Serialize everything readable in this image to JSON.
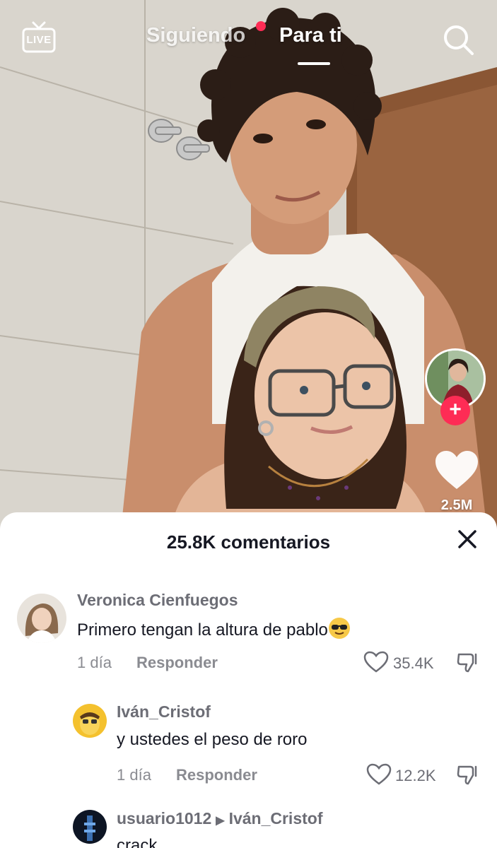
{
  "topbar": {
    "live_label": "LIVE",
    "tab_following": "Siguiendo",
    "tab_for_you": "Para ti",
    "active_tab": "Para ti"
  },
  "rail": {
    "like_count": "2.5M",
    "follow_symbol": "+"
  },
  "comments_sheet": {
    "title": "25.8K comentarios",
    "comments": [
      {
        "username": "Veronica Cienfuegos",
        "text": "Primero tengan la altura de pablo",
        "emoji": "smiling-face-with-sunglasses",
        "time": "1 día",
        "reply_label": "Responder",
        "likes": "35.4K"
      },
      {
        "username": "Iván_Cristof",
        "text": "y ustedes el peso de roro",
        "time": "1 día",
        "reply_label": "Responder",
        "likes": "12.2K"
      },
      {
        "username": "usuario1012",
        "reply_to": "Iván_Cristof",
        "text": "crack"
      }
    ]
  },
  "colors": {
    "accent": "#fe2c55",
    "text_primary": "#161823",
    "text_secondary": "#8a8b91"
  },
  "icons": [
    "live-tv-icon",
    "search-icon",
    "heart-icon",
    "close-icon",
    "dislike-icon",
    "play-arrow-icon"
  ]
}
